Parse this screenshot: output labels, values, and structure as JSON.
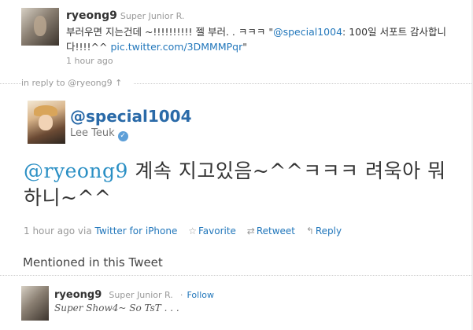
{
  "reply_tweet": {
    "screen_name": "ryeong9",
    "full_name": "Super Junior R.",
    "text_before": "부러우면 지는건데 ~!!!!!!!!!! 젤 부러. . ㅋㅋㅋ \"",
    "mention": "@special1004",
    "text_after": ": 100일 서포트 감사합니다!!!!^^ ",
    "link": "pic.twitter.com/3DMMMPqr",
    "link_suffix": "\"",
    "time": "1 hour ago"
  },
  "in_reply_to": "in reply to @ryeong9 ↑",
  "main_tweet": {
    "handle": "@special1004",
    "name": "Lee Teuk",
    "verified": "✓",
    "mention": "@ryeong9",
    "text": " 계속 지고있음~^^ㅋㅋㅋ 려욱아 뭐하니~^^",
    "time": "1 hour ago",
    "via_label": "via",
    "via_app": "Twitter for iPhone",
    "actions": {
      "favorite": "Favorite",
      "retweet": "Retweet",
      "reply": "Reply"
    },
    "icons": {
      "favorite": "star-outline-icon",
      "retweet": "retweet-icon",
      "reply": "reply-arrow-icon"
    }
  },
  "mentioned_section": {
    "title": "Mentioned in this Tweet",
    "user": {
      "screen_name": "ryeong9",
      "full_name": "Super Junior R.",
      "follow": "Follow",
      "bio": "Super Show4~ So TsT . . ."
    }
  },
  "colors": {
    "link": "#2277bb",
    "handle": "#2a6aa8",
    "mention": "#2a8fc4",
    "muted": "#999999"
  }
}
